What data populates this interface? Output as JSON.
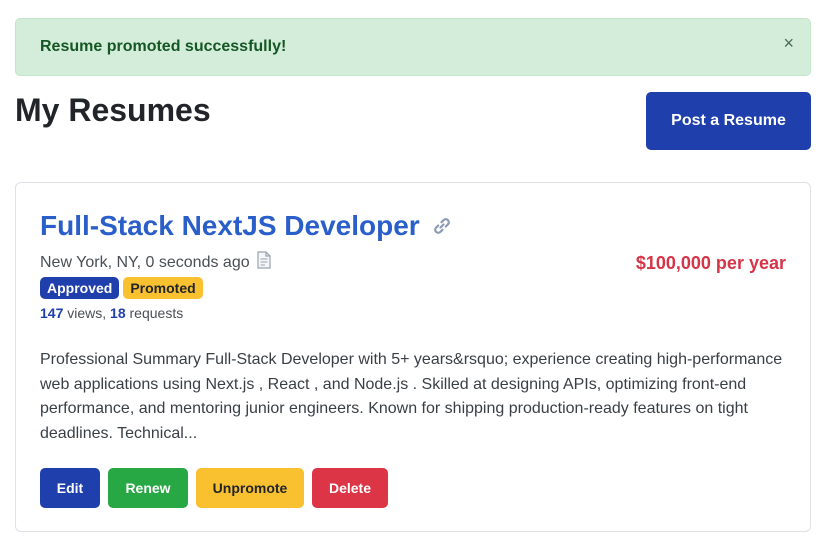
{
  "alert": {
    "message": "Resume promoted successfully!",
    "close_label": "×"
  },
  "header": {
    "title": "My Resumes",
    "post_button": "Post a Resume"
  },
  "resume": {
    "title": "Full-Stack NextJS Developer",
    "location_time": "New York, NY, 0 seconds ago",
    "salary": "$100,000 per year",
    "badges": [
      "Approved",
      "Promoted"
    ],
    "views": "147",
    "views_label": " views, ",
    "requests": "18",
    "requests_label": " requests",
    "description": "Professional Summary Full-Stack Developer with 5+ years&rsquo; experience creating high-performance web applications using Next.js , React , and Node.js . Skilled at designing APIs, optimizing front-end performance, and mentoring junior engineers. Known for shipping production-ready features on tight deadlines. Technical...",
    "actions": {
      "edit": "Edit",
      "renew": "Renew",
      "unpromote": "Unpromote",
      "delete": "Delete"
    }
  },
  "colors": {
    "primary": "#1f3fad",
    "link": "#2a5fc9",
    "success": "#28a745",
    "warning": "#f9c12f",
    "danger": "#dc3545",
    "alert_bg": "#d4edda"
  }
}
